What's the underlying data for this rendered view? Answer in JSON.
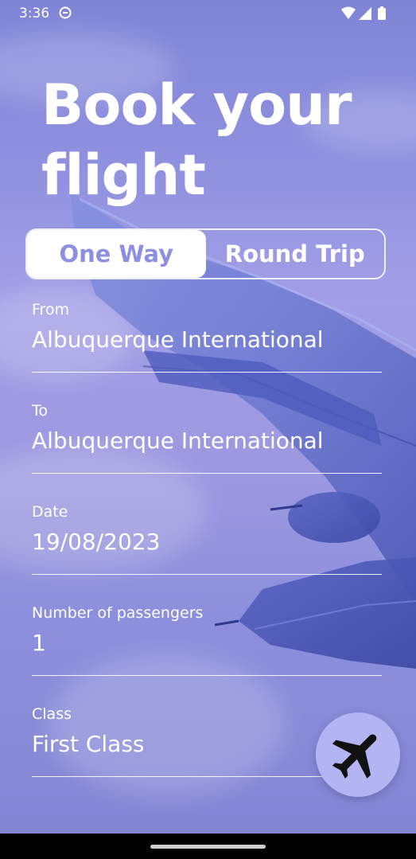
{
  "status_bar": {
    "time": "3:36"
  },
  "title": {
    "line1": "Book your",
    "line2": "flight"
  },
  "trip_toggle": {
    "options": [
      "One Way",
      "Round Trip"
    ],
    "selected": "One Way"
  },
  "form": {
    "from": {
      "label": "From",
      "value": "Albuquerque International"
    },
    "to": {
      "label": "To",
      "value": "Albuquerque International"
    },
    "date": {
      "label": "Date",
      "value": "19/08/2023"
    },
    "passengers": {
      "label": "Number of passengers",
      "value": "1"
    },
    "class": {
      "label": "Class",
      "value": "First Class"
    }
  },
  "icons": {
    "fab": "airplane-icon",
    "status": [
      "dnd-icon",
      "wifi-icon",
      "signal-icon",
      "battery-icon"
    ]
  },
  "colors": {
    "accent": "#8d8fe0",
    "fab_background": "#b3b5f2",
    "text": "#ffffff",
    "nav_bar": "#000000"
  }
}
